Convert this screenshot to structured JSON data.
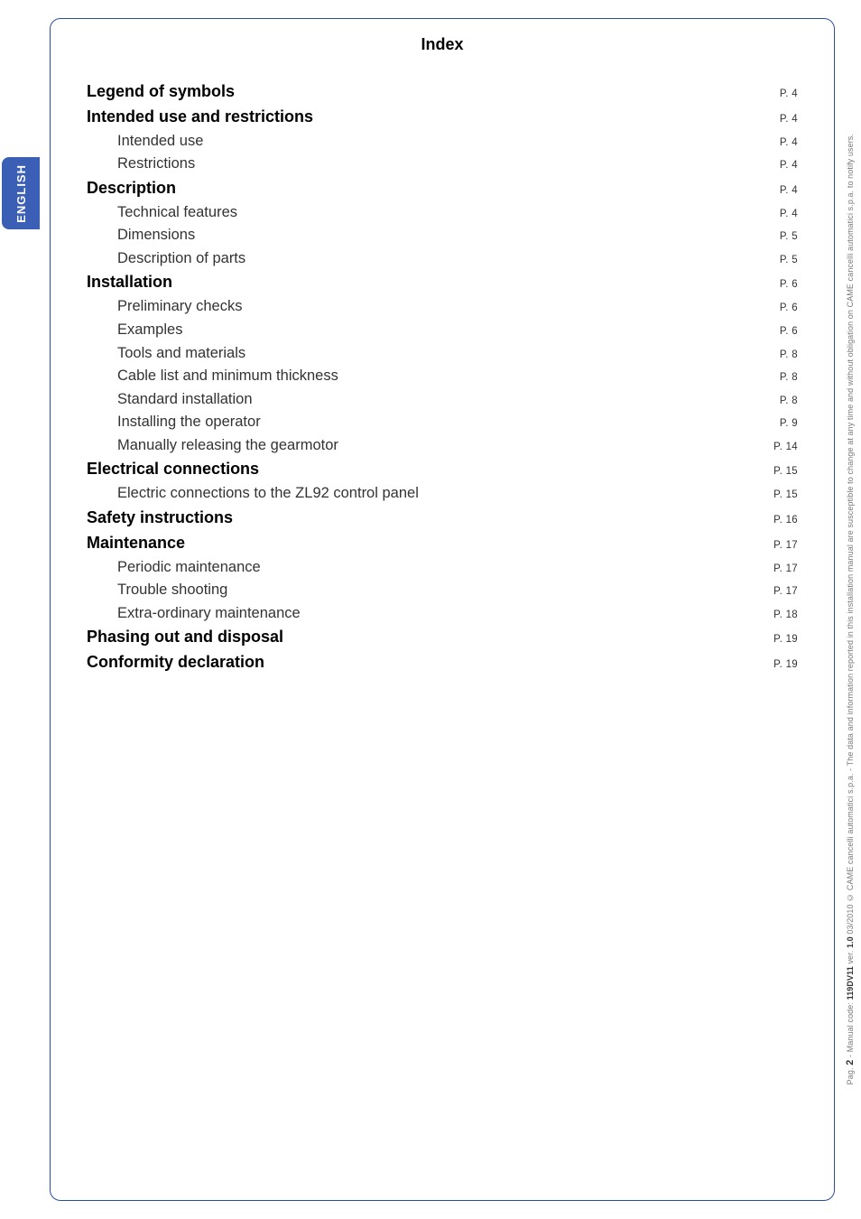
{
  "lang_tab": "ENGLISH",
  "index_heading": "Index",
  "toc": [
    {
      "label": "Legend of symbols",
      "page": "P. 4",
      "type": "h"
    },
    {
      "label": "Intended use and restrictions",
      "page": "P. 4",
      "type": "h"
    },
    {
      "label": "Intended use",
      "page": "P. 4",
      "type": "s"
    },
    {
      "label": "Restrictions",
      "page": "P. 4",
      "type": "s"
    },
    {
      "label": "Description",
      "page": "P. 4",
      "type": "h"
    },
    {
      "label": "Technical features",
      "page": "P. 4",
      "type": "s"
    },
    {
      "label": "Dimensions",
      "page": "P. 5",
      "type": "s"
    },
    {
      "label": "Description of parts",
      "page": "P. 5",
      "type": "s"
    },
    {
      "label": "Installation",
      "page": "P. 6",
      "type": "h"
    },
    {
      "label": "Preliminary checks",
      "page": "P. 6",
      "type": "s"
    },
    {
      "label": "Examples",
      "page": "P. 6",
      "type": "s"
    },
    {
      "label": "Tools and materials",
      "page": "P. 8",
      "type": "s"
    },
    {
      "label": "Cable list and minimum thickness",
      "page": "P. 8",
      "type": "s"
    },
    {
      "label": "Standard installation",
      "page": "P. 8",
      "type": "s"
    },
    {
      "label": "Installing the operator",
      "page": "P. 9",
      "type": "s"
    },
    {
      "label": "Manually releasing the gearmotor",
      "page": "P. 14",
      "type": "s"
    },
    {
      "label": "Electrical connections",
      "page": "P. 15",
      "type": "h"
    },
    {
      "label": "Electric connections to the ZL92  control panel",
      "page": "P. 15",
      "type": "s"
    },
    {
      "label": "Safety instructions",
      "page": "P. 16",
      "type": "h"
    },
    {
      "label": "Maintenance",
      "page": "P. 17",
      "type": "h"
    },
    {
      "label": "Periodic maintenance",
      "page": "P. 17",
      "type": "s"
    },
    {
      "label": "Trouble shooting",
      "page": "P. 17",
      "type": "s"
    },
    {
      "label": "Extra-ordinary maintenance",
      "page": "P. 18",
      "type": "s"
    },
    {
      "label": "Phasing out and disposal",
      "page": "P. 19",
      "type": "h"
    },
    {
      "label": "Conformity declaration",
      "page": "P. 19",
      "type": "h"
    }
  ],
  "footer": {
    "page_label": "Pag.",
    "page_num": "2",
    "sep1": " - Manual code: ",
    "code": "119DV11",
    "ver_label": " ver. ",
    "ver": "1.0",
    "date": "  03/2010  © CAME cancelli automatici s.p.a. - The data and information reported in this installation manual are susceptible to change at any time and without obligation on CAME cancelli automatici s.p.a. to notify users."
  }
}
